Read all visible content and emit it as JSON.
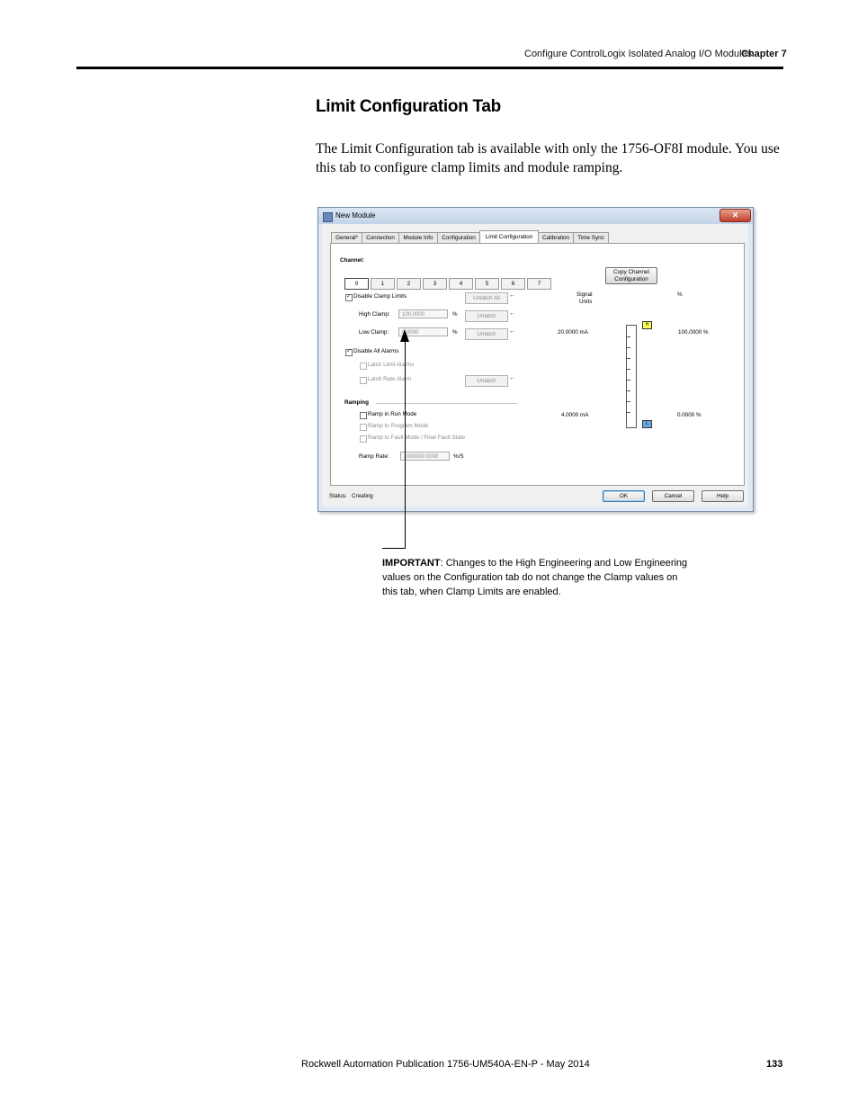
{
  "header": {
    "section": "Configure ControlLogix Isolated Analog I/O Modules",
    "chapter": "Chapter 7"
  },
  "heading": "Limit Configuration Tab",
  "intro": "The Limit Configuration tab is available with only the 1756-OF8I module. You use this tab to configure clamp limits and module ramping.",
  "dialog": {
    "title": "New Module",
    "close_label": "✕",
    "tabs": [
      "General*",
      "Connection",
      "Module Info",
      "Configuration",
      "Limit Configuration",
      "Calibration",
      "Time Sync"
    ],
    "active_tab": "Limit Configuration",
    "channel_label": "Channel:",
    "channels": [
      "0",
      "1",
      "2",
      "3",
      "4",
      "5",
      "6",
      "7"
    ],
    "copy_channel_label_1": "Copy Channel",
    "copy_channel_label_2": "Configuration",
    "disable_clamp_limits": "Disable Clamp Limits",
    "unlatch_all": "Unlatch All",
    "high_clamp_label": "High Clamp:",
    "high_clamp_value": "100.0000",
    "low_clamp_label": "Low Clamp:",
    "low_clamp_value": "0.0000",
    "percent": "%",
    "unlatch": "Unlatch",
    "disable_all_alarms": "Disable All Alarms",
    "latch_limit_alarms": "Latch Limit Alarms",
    "latch_rate_alarm": "Latch Rate Alarm",
    "ramping_label": "Ramping",
    "ramp_in_run_mode": "Ramp in Run Mode",
    "ramp_to_program_mode": "Ramp to Program Mode",
    "ramp_to_fault_mode": "Ramp to Fault Mode / Final Fault State",
    "ramp_rate_label": "Ramp Rate:",
    "ramp_rate_value": "1000000.0000",
    "ramp_rate_unit": "%/S",
    "signal_units_1": "Signal",
    "signal_units_2": "Units",
    "pct_header": "%",
    "high_signal": "20.0000 mA",
    "high_pct": "100.0000 %",
    "low_signal": "4.0000 mA",
    "low_pct": "0.0000 %",
    "marker_high": "H",
    "marker_low": "L",
    "status_label": "Status:",
    "status_value": "Creating",
    "ok": "OK",
    "cancel": "Cancel",
    "help": "Help"
  },
  "important": {
    "label": "IMPORTANT",
    "text": ": Changes to the High Engineering and Low Engineering values on the Configuration tab do not change the Clamp values on this tab, when Clamp Limits are enabled."
  },
  "footer": {
    "publication": "Rockwell Automation Publication 1756-UM540A-EN-P - May 2014",
    "page_number": "133"
  }
}
